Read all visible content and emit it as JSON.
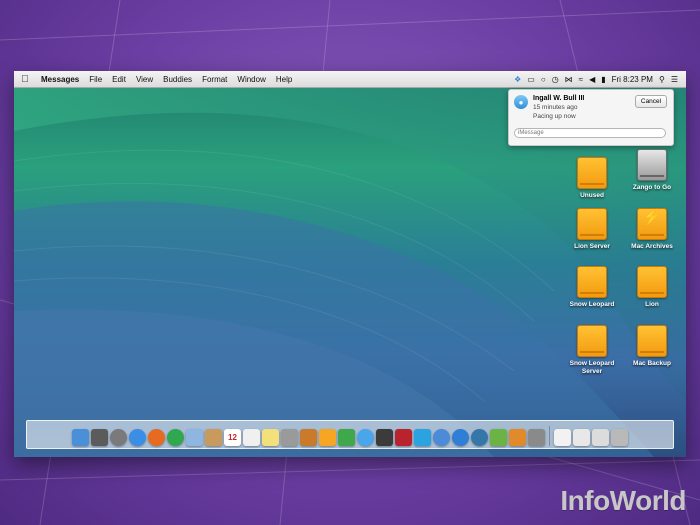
{
  "menubar": {
    "app_name": "Messages",
    "menus": [
      "File",
      "Edit",
      "View",
      "Buddies",
      "Format",
      "Window",
      "Help"
    ],
    "clock": "Fri 8:23 PM"
  },
  "notification": {
    "sender": "Ingall W. Bull III",
    "time": "15 minutes ago",
    "message": "Pacing up now",
    "cancel_label": "Cancel",
    "reply_placeholder": "iMessage"
  },
  "desktop_icons": [
    {
      "label": "Unused",
      "kind": "drive"
    },
    {
      "label": "Zango to Go",
      "kind": "internal-disk"
    },
    {
      "label": "Lion Server",
      "kind": "drive"
    },
    {
      "label": "Mac Archives",
      "kind": "thunderbolt-drive"
    },
    {
      "label": "Snow Leopard",
      "kind": "drive"
    },
    {
      "label": "Lion",
      "kind": "drive"
    },
    {
      "label": "Snow Leopard Server",
      "kind": "drive"
    },
    {
      "label": "Mac Backup",
      "kind": "drive"
    }
  ],
  "dock": {
    "apps": [
      {
        "name": "finder-icon",
        "color": "#4a90d9"
      },
      {
        "name": "dashboard-icon",
        "color": "#5b5b5b"
      },
      {
        "name": "launchpad-icon",
        "color": "#7a7a7a"
      },
      {
        "name": "safari-icon",
        "color": "#3a8ee6"
      },
      {
        "name": "firefox-icon",
        "color": "#e66a1f"
      },
      {
        "name": "chrome-icon",
        "color": "#2fa84f"
      },
      {
        "name": "mail-icon",
        "color": "#8fb6e0"
      },
      {
        "name": "contacts-icon",
        "color": "#c89a5e"
      },
      {
        "name": "calendar-icon",
        "color": "#ffffff",
        "text": "12"
      },
      {
        "name": "reminders-icon",
        "color": "#f0f0f0"
      },
      {
        "name": "notes-icon",
        "color": "#f3e07a"
      },
      {
        "name": "textedit-icon",
        "color": "#9a9a9a"
      },
      {
        "name": "keynote-icon",
        "color": "#c97a2a"
      },
      {
        "name": "pages-icon",
        "color": "#f6a623"
      },
      {
        "name": "numbers-icon",
        "color": "#3ea84a"
      },
      {
        "name": "messages-icon",
        "color": "#4aa6ea"
      },
      {
        "name": "facetime-icon",
        "color": "#3b3b3b"
      },
      {
        "name": "photo-booth-icon",
        "color": "#b8232e"
      },
      {
        "name": "twitter-icon",
        "color": "#2aa3e0"
      },
      {
        "name": "itunes-icon",
        "color": "#4d8ad8"
      },
      {
        "name": "app-store-icon",
        "color": "#2f7fd6"
      },
      {
        "name": "wordpress-icon",
        "color": "#3577a8"
      },
      {
        "name": "evernote-icon",
        "color": "#6bb344"
      },
      {
        "name": "transmit-icon",
        "color": "#e08a2b"
      },
      {
        "name": "system-preferences-icon",
        "color": "#8a8a8a"
      }
    ],
    "stacks": [
      {
        "name": "documents-stack-icon",
        "color": "#f2f2f2"
      },
      {
        "name": "downloads-stack-icon",
        "color": "#e8e8e8"
      },
      {
        "name": "applications-stack-icon",
        "color": "#dcdcdc"
      },
      {
        "name": "trash-icon",
        "color": "#b9b9b9"
      }
    ]
  },
  "branding": {
    "logo": "InfoWorld"
  }
}
